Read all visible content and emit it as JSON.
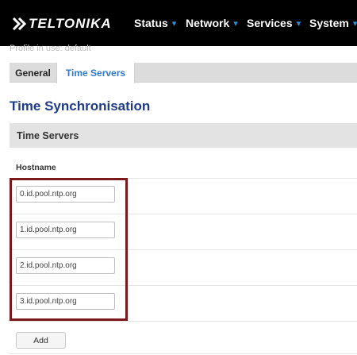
{
  "header": {
    "brand": "TELTONIKA",
    "logo_icon": "teltonika-logo-icon",
    "nav": [
      {
        "label": "Status"
      },
      {
        "label": "Network"
      },
      {
        "label": "Services"
      },
      {
        "label": "System"
      }
    ],
    "caret_glyph": "▾"
  },
  "profile": {
    "text": "Profile in use: default"
  },
  "tabs": [
    {
      "label": "General",
      "active": false
    },
    {
      "label": "Time Servers",
      "active": true
    }
  ],
  "page_title": "Time Synchronisation",
  "section": {
    "title": "Time Servers",
    "column_header": "Hostname",
    "servers": [
      {
        "hostname": "0.id.pool.ntp.org"
      },
      {
        "hostname": "1.id.pool.ntp.org"
      },
      {
        "hostname": "2.id.pool.ntp.org"
      },
      {
        "hostname": "3.id.pool.ntp.org"
      }
    ],
    "add_label": "Add"
  },
  "colors": {
    "topbar": "#000000",
    "accent_blue": "#2e7bcb",
    "title_blue": "#1f3a8a",
    "highlight": "#7a1a1a"
  }
}
